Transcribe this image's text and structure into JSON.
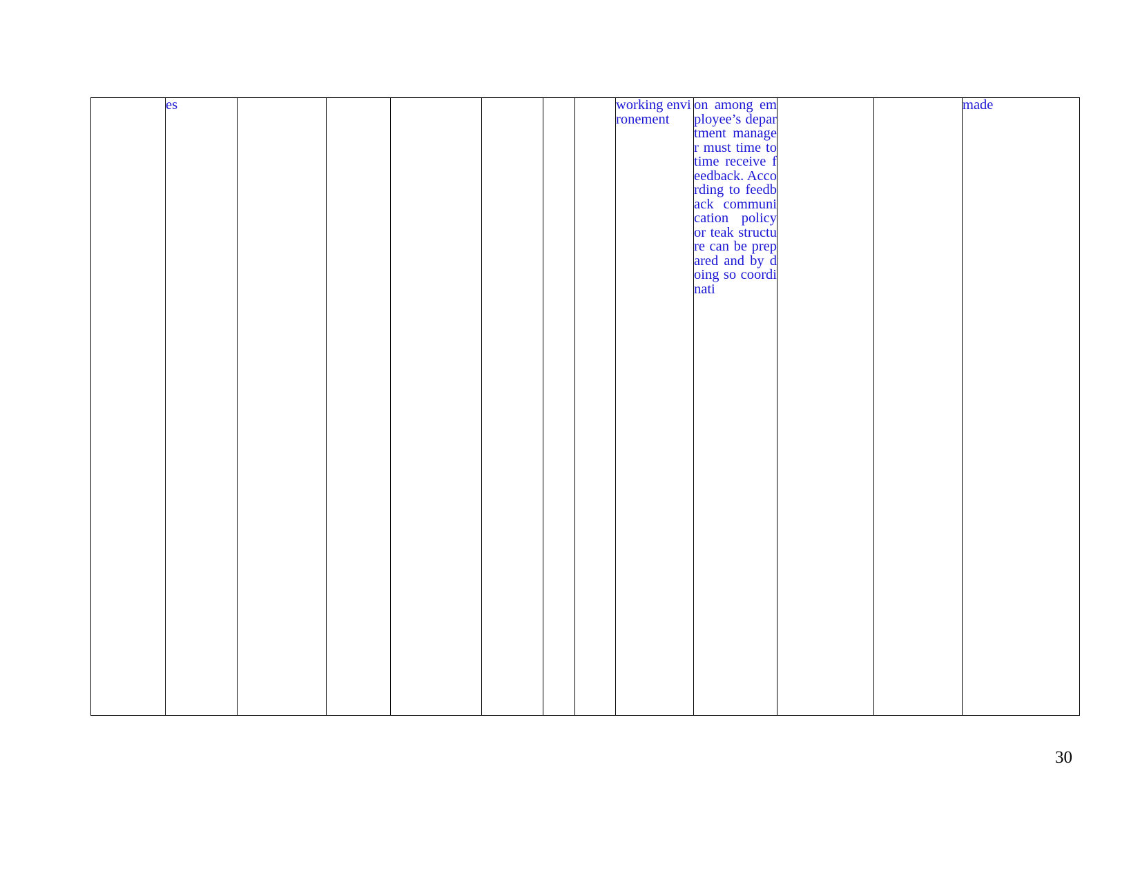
{
  "document": {
    "page_number": "30",
    "text_color": "#1a16d4",
    "page_number_color": "#000000",
    "background_color": "#ffffff",
    "border_color": "#000000"
  },
  "table": {
    "columns": 13,
    "rows": 1,
    "row": {
      "cells": [
        {
          "index": 0,
          "text": ""
        },
        {
          "index": 1,
          "text": "es"
        },
        {
          "index": 2,
          "text": ""
        },
        {
          "index": 3,
          "text": ""
        },
        {
          "index": 4,
          "text": ""
        },
        {
          "index": 5,
          "text": ""
        },
        {
          "index": 6,
          "text": ""
        },
        {
          "index": 7,
          "text": ""
        },
        {
          "index": 8,
          "text": "working environement"
        },
        {
          "index": 9,
          "text": "on among employee’s department manager must time to time receive feedback. According to feedback communication policy or teak structure can be prepared and by doing so coordinati"
        },
        {
          "index": 10,
          "text": ""
        },
        {
          "index": 11,
          "text": ""
        },
        {
          "index": 12,
          "text": "made"
        }
      ]
    }
  }
}
